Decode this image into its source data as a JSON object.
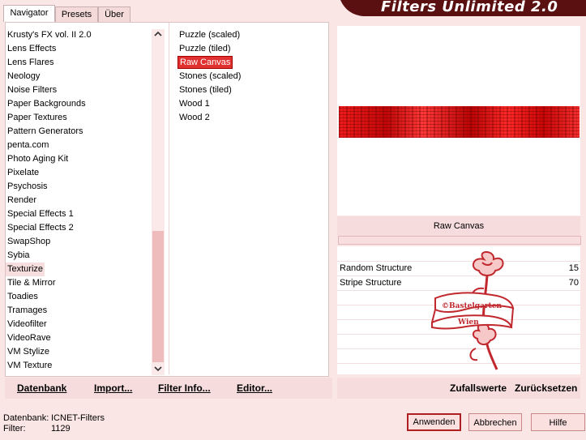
{
  "app": {
    "title": "Filters Unlimited 2.0"
  },
  "tabs": [
    {
      "label": "Navigator",
      "active": true
    },
    {
      "label": "Presets",
      "active": false
    },
    {
      "label": "Über",
      "active": false
    }
  ],
  "categories": [
    "Krusty's FX vol. II 2.0",
    "Lens Effects",
    "Lens Flares",
    "Neology",
    "Noise Filters",
    "Paper Backgrounds",
    "Paper Textures",
    "Pattern Generators",
    "penta.com",
    "Photo Aging Kit",
    "Pixelate",
    "Psychosis",
    "Render",
    "Special Effects 1",
    "Special Effects 2",
    "SwapShop",
    "Sybia",
    "Texturize",
    "Tile & Mirror",
    "Toadies",
    "Tramages",
    "Videofilter",
    "VideoRave",
    "VM Stylize",
    "VM Texture"
  ],
  "selected_category": "Texturize",
  "filters": [
    "Puzzle (scaled)",
    "Puzzle (tiled)",
    "Raw Canvas",
    "Stones (scaled)",
    "Stones (tiled)",
    "Wood 1",
    "Wood 2"
  ],
  "selected_filter": "Raw Canvas",
  "scroll_icons": {
    "up": "chevron-up-icon",
    "down": "chevron-down-icon"
  },
  "preview": {
    "filter_name": "Raw Canvas"
  },
  "params": [
    {
      "label": "Random Structure",
      "value": "15"
    },
    {
      "label": "Stripe Structure",
      "value": "70"
    }
  ],
  "watermark": {
    "text_line1": "©Bastelgarten",
    "text_line2": "Wien"
  },
  "toolbar_left": {
    "database": "Datenbank",
    "import": "Import...",
    "filter_info": "Filter Info...",
    "editor": "Editor..."
  },
  "toolbar_right": {
    "random": "Zufallswerte",
    "reset": "Zurücksetzen"
  },
  "status": {
    "database_label": "Datenbank:",
    "database_value": "ICNET-Filters",
    "filter_label": "Filter:",
    "filter_value": "1129"
  },
  "buttons": {
    "apply": "Anwenden",
    "cancel": "Abbrechen",
    "help": "Hilfe"
  },
  "colors": {
    "selection": "#e03030",
    "banner": "#5a1010",
    "background": "#fbe6e6"
  }
}
